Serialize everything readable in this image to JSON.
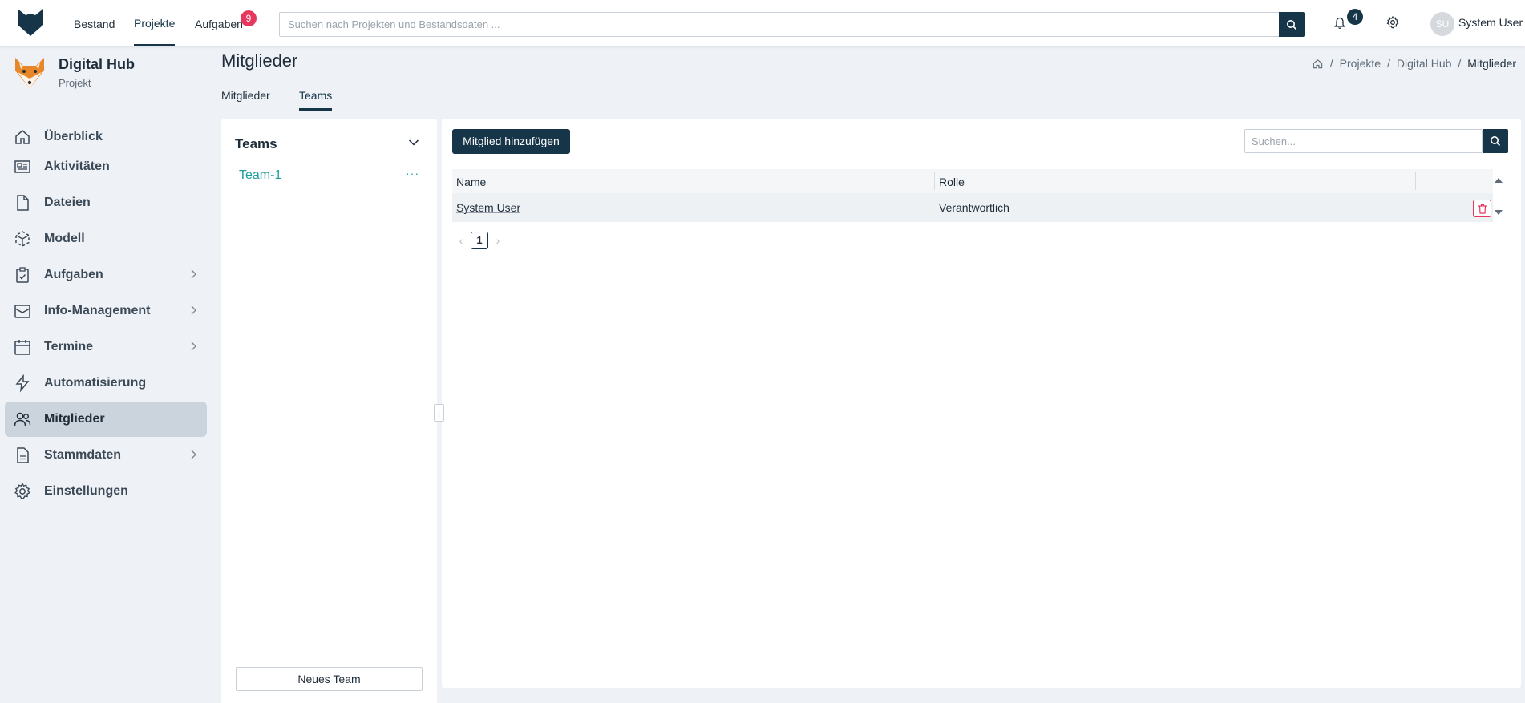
{
  "topnav": {
    "items": [
      {
        "label": "Bestand"
      },
      {
        "label": "Projekte"
      },
      {
        "label": "Aufgaben",
        "badge": "9"
      }
    ],
    "search_placeholder": "Suchen nach Projekten und Bestandsdaten ...",
    "notifications_count": "4",
    "user_initials": "SU",
    "user_name": "System User"
  },
  "project": {
    "name": "Digital Hub",
    "subtitle": "Projekt"
  },
  "sidebar": {
    "items": [
      {
        "label": "Überblick",
        "icon": "home-icon"
      },
      {
        "label": "Aktivitäten",
        "icon": "newspaper-icon"
      },
      {
        "label": "Dateien",
        "icon": "file-icon"
      },
      {
        "label": "Modell",
        "icon": "model-cube-icon"
      },
      {
        "label": "Aufgaben",
        "icon": "clipboard-check-icon"
      },
      {
        "label": "Info-Management",
        "icon": "inbox-icon"
      },
      {
        "label": "Termine",
        "icon": "calendar-icon"
      },
      {
        "label": "Automatisierung",
        "icon": "lightning-icon"
      },
      {
        "label": "Mitglieder",
        "icon": "users-icon"
      },
      {
        "label": "Stammdaten",
        "icon": "document-icon"
      },
      {
        "label": "Einstellungen",
        "icon": "gear-icon"
      }
    ]
  },
  "page": {
    "title": "Mitglieder",
    "breadcrumb": [
      "Projekte",
      "Digital Hub",
      "Mitglieder"
    ],
    "tabs": [
      {
        "label": "Mitglieder"
      },
      {
        "label": "Teams"
      }
    ]
  },
  "teams_panel": {
    "title": "Teams",
    "items": [
      "Team-1"
    ],
    "more_label": "···",
    "new_team_label": "Neues Team"
  },
  "members_panel": {
    "add_label": "Mitglied hinzufügen",
    "search_placeholder": "Suchen...",
    "columns": [
      "Name",
      "Rolle"
    ],
    "rows": [
      {
        "name": "System User",
        "role": "Verantwortlich"
      }
    ],
    "page": "1"
  },
  "colors": {
    "primary": "#163549",
    "accent_teal": "#1f9e9e",
    "badge_red": "#e8375f",
    "background": "#eef1f5"
  }
}
